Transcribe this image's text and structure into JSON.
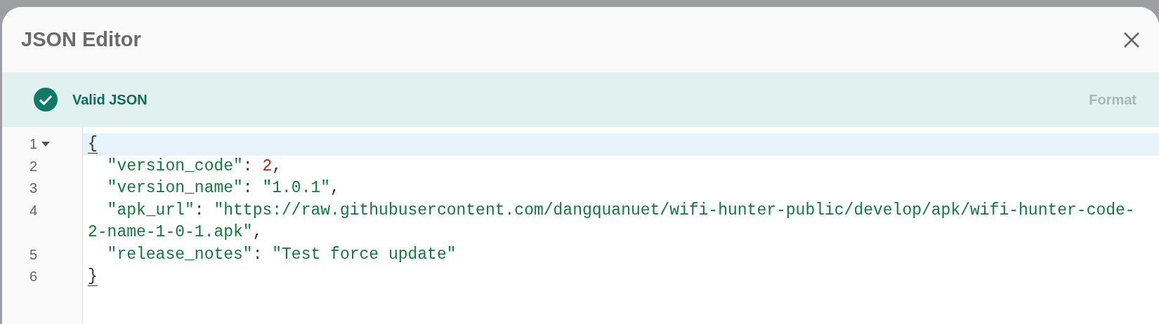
{
  "dialog": {
    "title": "JSON Editor",
    "status": {
      "valid": true,
      "message": "Valid JSON"
    },
    "format_button": {
      "label": "Format",
      "disabled": true
    },
    "editor": {
      "lines": [
        {
          "number": "1",
          "expanded": true,
          "highlighted": true,
          "tokens": [
            {
              "kind": "punct",
              "text": "{",
              "bracket_match": true
            }
          ]
        },
        {
          "number": "2",
          "highlighted": false,
          "tokens": [
            {
              "kind": "key",
              "text": "  \"version_code\""
            },
            {
              "kind": "punct",
              "text": ": "
            },
            {
              "kind": "number",
              "text": "2"
            },
            {
              "kind": "punct",
              "text": ","
            }
          ]
        },
        {
          "number": "3",
          "highlighted": false,
          "tokens": [
            {
              "kind": "key",
              "text": "  \"version_name\""
            },
            {
              "kind": "punct",
              "text": ": "
            },
            {
              "kind": "string",
              "text": "\"1.0.1\""
            },
            {
              "kind": "punct",
              "text": ","
            }
          ]
        },
        {
          "number": "4",
          "highlighted": false,
          "tokens": [
            {
              "kind": "key",
              "text": "  \"apk_url\""
            },
            {
              "kind": "punct",
              "text": ": "
            },
            {
              "kind": "string",
              "text": "\"https://raw.githubusercontent.com/dangquanuet/wifi-hunter-public/develop/apk/wifi-hunter-code-2-name-1-0-1.apk\""
            },
            {
              "kind": "punct",
              "text": ","
            }
          ]
        },
        {
          "number": "5",
          "highlighted": false,
          "tokens": [
            {
              "kind": "key",
              "text": "  \"release_notes\""
            },
            {
              "kind": "punct",
              "text": ": "
            },
            {
              "kind": "string",
              "text": "\"Test force update\""
            }
          ]
        },
        {
          "number": "6",
          "highlighted": false,
          "tokens": [
            {
              "kind": "punct",
              "text": "}",
              "bracket_match": true
            }
          ]
        }
      ]
    }
  }
}
